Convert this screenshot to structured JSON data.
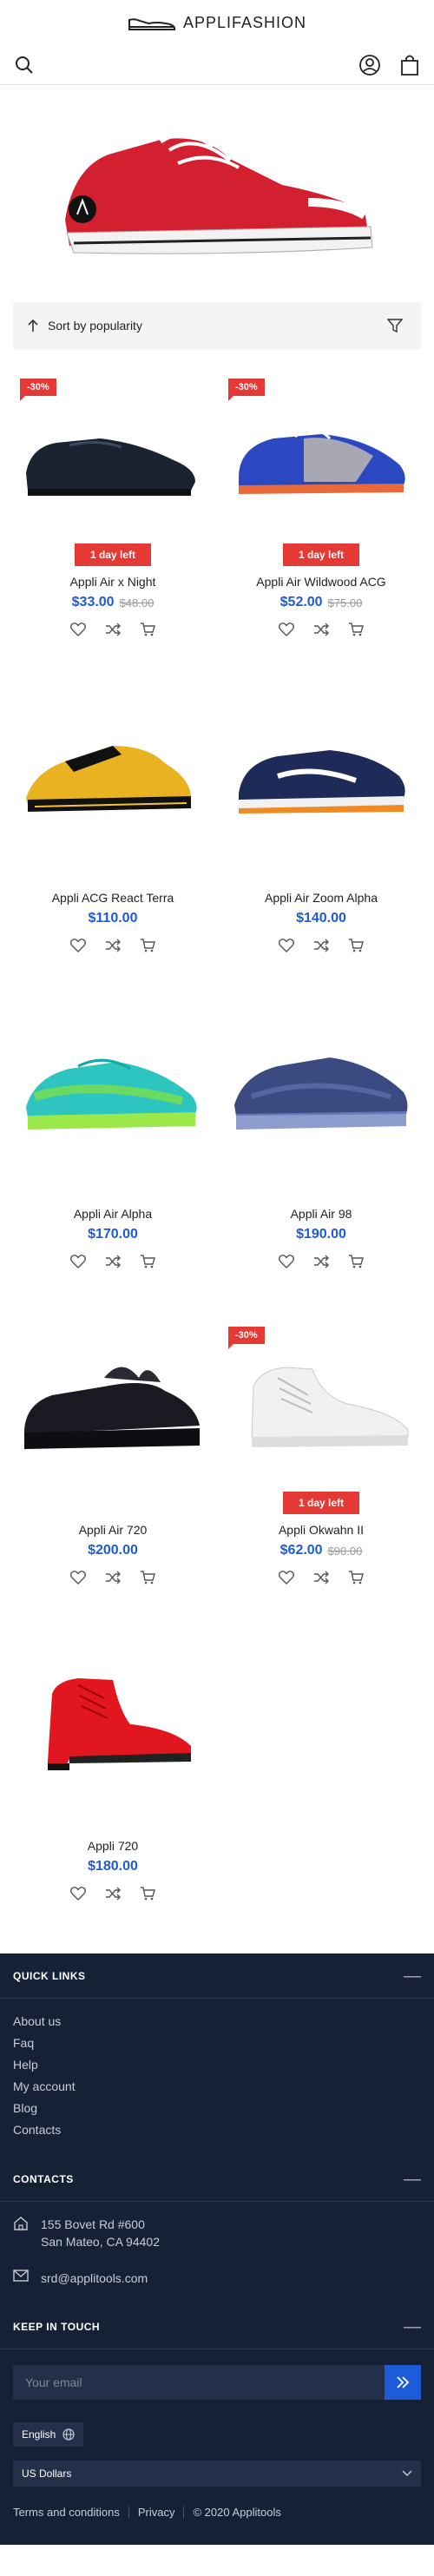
{
  "header": {
    "logo_text": "APPLIFASHION",
    "icons": [
      "search-icon",
      "user-icon",
      "shopping-bag-icon"
    ]
  },
  "hero": {
    "alt": "red-sneaker"
  },
  "sort": {
    "label": "Sort by popularity"
  },
  "products": [
    {
      "name": "Appli Air x Night",
      "price": "$33.00",
      "old_price": "$48.00",
      "badge": "-30%",
      "countdown": "1 day left",
      "shoe": "dark-oxford"
    },
    {
      "name": "Appli Air Wildwood ACG",
      "price": "$52.00",
      "old_price": "$75.00",
      "badge": "-30%",
      "countdown": "1 day left",
      "shoe": "blue-suede"
    },
    {
      "name": "Appli ACG React Terra",
      "price": "$110.00",
      "old_price": "",
      "badge": "",
      "countdown": "",
      "shoe": "yellow-sock"
    },
    {
      "name": "Appli Air Zoom Alpha",
      "price": "$140.00",
      "old_price": "",
      "badge": "",
      "countdown": "",
      "shoe": "navy-runner"
    },
    {
      "name": "Appli Air Alpha",
      "price": "$170.00",
      "old_price": "",
      "badge": "",
      "countdown": "",
      "shoe": "teal-knit"
    },
    {
      "name": "Appli Air 98",
      "price": "$190.00",
      "old_price": "",
      "badge": "",
      "countdown": "",
      "shoe": "navy-knit"
    },
    {
      "name": "Appli Air 720",
      "price": "$200.00",
      "old_price": "",
      "badge": "",
      "countdown": "",
      "shoe": "black-platform"
    },
    {
      "name": "Appli Okwahn II",
      "price": "$62.00",
      "old_price": "$90.00",
      "badge": "-30%",
      "countdown": "1 day left",
      "shoe": "white-hightop"
    },
    {
      "name": "Appli 720",
      "price": "$180.00",
      "old_price": "",
      "badge": "",
      "countdown": "",
      "shoe": "red-boot"
    }
  ],
  "footer": {
    "quick_links_title": "QUICK LINKS",
    "links": [
      "About us",
      "Faq",
      "Help",
      "My account",
      "Blog",
      "Contacts"
    ],
    "contacts_title": "CONTACTS",
    "address_line1": "155 Bovet Rd #600",
    "address_line2": "San Mateo, CA 94402",
    "email": "srd@applitools.com",
    "keep_in_touch_title": "KEEP IN TOUCH",
    "email_placeholder": "Your email",
    "language": "English",
    "currency": "US Dollars",
    "terms": "Terms and conditions",
    "privacy": "Privacy",
    "copyright": "© 2020 Applitools"
  },
  "colors": {
    "accent": "#1e5bd8",
    "sale": "#e53935",
    "footer_bg": "#172136"
  }
}
